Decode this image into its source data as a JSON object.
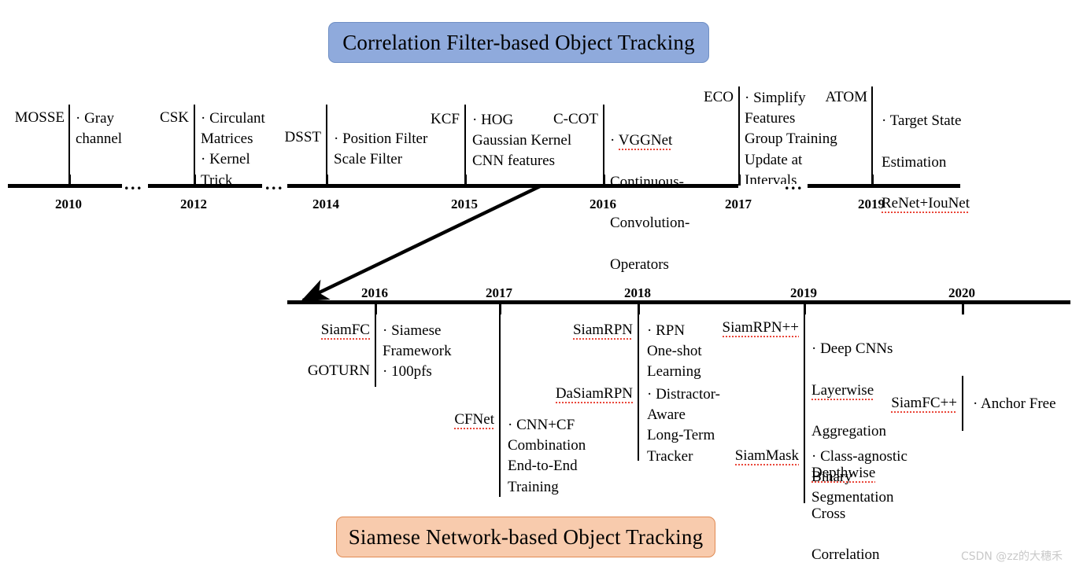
{
  "banners": {
    "top": "Correlation Filter-based Object Tracking",
    "bottom": "Siamese Network-based Object Tracking"
  },
  "watermark": "CSDN @zz的大穗禾",
  "colors": {
    "top_banner_fill": "#8FAADC",
    "top_banner_border": "#6F8FC4",
    "bottom_banner_fill": "#F8CBAD",
    "bottom_banner_border": "#E08A53",
    "line": "#000000",
    "spellcheck_underline": "#E8392B",
    "watermark": "#C9C9C9"
  },
  "top_timeline": {
    "name": "Correlation Filter-based Object Tracking",
    "years": [
      "2010",
      "2012",
      "2014",
      "2015",
      "2016",
      "2017",
      "2019"
    ],
    "gap_markers": [
      "...",
      "...",
      "..."
    ],
    "entries": [
      {
        "method": "MOSSE",
        "year": "2010",
        "details": "· Gray\nchannel"
      },
      {
        "method": "CSK",
        "year": "2012",
        "details": "· Circulant\nMatrices\n· Kernel\nTrick"
      },
      {
        "method": "DSST",
        "year": "2014",
        "details": "· Position Filter\nScale Filter"
      },
      {
        "method": "KCF",
        "year": "2015",
        "details": "· HOG\nGaussian Kernel\nCNN features"
      },
      {
        "method": "C-COT",
        "year": "2016",
        "details": "· VGGNet\nContinuous-\nConvolution-\nOperators",
        "details_spellchecked": [
          "VGGNet"
        ]
      },
      {
        "method": "ECO",
        "year": "2017",
        "details": "· Simplify\nFeatures\nGroup Training\nUpdate at\nIntervals"
      },
      {
        "method": "ATOM",
        "year": "2019",
        "details": "· Target State\nEstimation\nReNet+IouNet",
        "details_spellchecked": [
          "ReNet+IouNet"
        ]
      }
    ]
  },
  "bottom_timeline": {
    "name": "Siamese Network-based Object Tracking",
    "years": [
      "2016",
      "2017",
      "2018",
      "2019",
      "2020"
    ],
    "entries": [
      {
        "method": "SiamFC",
        "method2": "GOTURN",
        "year": "2016",
        "details": "· Siamese\nFramework\n· 100pfs",
        "method_spellchecked": true
      },
      {
        "method": "CFNet",
        "year": "2017",
        "details": "· CNN+CF\nCombination\nEnd-to-End\nTraining",
        "method_spellchecked": true
      },
      {
        "method": "SiamRPN",
        "year": "2018",
        "details": "· RPN\nOne-shot\nLearning",
        "method_spellchecked": true
      },
      {
        "method": "DaSiamRPN",
        "year": "2018",
        "details": "· Distractor-\nAware\nLong-Term\nTracker",
        "method_spellchecked": true
      },
      {
        "method": "SiamRPN++",
        "year": "2019",
        "details": "· Deep CNNs\nLayerwise\nAggregation\nDepthwise\nCross\nCorrelation",
        "method_spellchecked": true,
        "details_spellchecked": [
          "Layerwise",
          "Depthwise"
        ]
      },
      {
        "method": "SiamMask",
        "year": "2019",
        "details": "· Class-agnostic\nBinary\nSegmentation",
        "method_spellchecked": true
      },
      {
        "method": "SiamFC++",
        "year": "2020",
        "details": "· Anchor Free",
        "method_spellchecked": true
      }
    ]
  },
  "connector": {
    "label": "arrow from Correlation Filter timeline (2015) down to Siamese timeline (2016 start)"
  }
}
